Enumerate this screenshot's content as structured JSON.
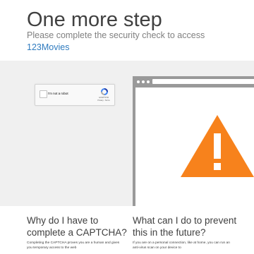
{
  "header": {
    "title": "One more step",
    "subtitle": "Please complete the security check to access",
    "site": "123Movies"
  },
  "captcha": {
    "checkbox_label": "I'm not a robot",
    "brand": "reCAPTCHA",
    "links": "Privacy - Terms"
  },
  "illustration": {
    "icon": "warning-triangle-icon",
    "accent_color": "#f7821c",
    "frame_color": "#999999"
  },
  "sections": {
    "why": {
      "heading": "Why do I have to complete a CAPTCHA?",
      "body": "Completing the CAPTCHA proves you are a human and gives you temporary access to the web"
    },
    "prevent": {
      "heading": "What can I do to prevent this in the future?",
      "body": "If you are on a personal connection, like at home, you can run an anti-virus scan on your device to"
    }
  },
  "colors": {
    "band_background": "#f0f0f0",
    "link": "#2f7bbf"
  }
}
